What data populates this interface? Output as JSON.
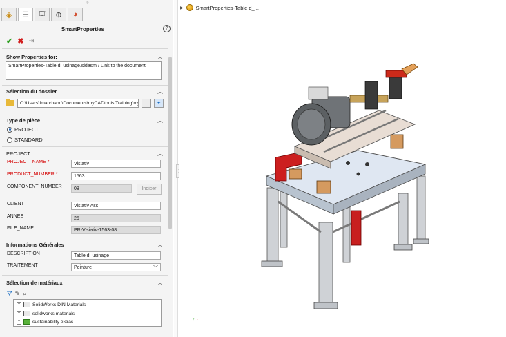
{
  "panel": {
    "title": "SmartProperties",
    "help": "?"
  },
  "show_properties": {
    "heading": "Show Properties for:",
    "value": "SmartProperties-Table d_usinage.sldasm / Link to the document"
  },
  "folder": {
    "heading": "Sélection du dossier",
    "path": "C:\\Users\\fmarchand\\Documents\\myCADtools Training\\my",
    "browse_label": "..."
  },
  "part_type": {
    "heading": "Type de pièce",
    "options": [
      "PROJECT",
      "STANDARD"
    ],
    "selected": "PROJECT"
  },
  "project": {
    "heading": "PROJECT",
    "fields": [
      {
        "label": "PROJECT_NAME *",
        "value": "Visiativ",
        "required": true
      },
      {
        "label": "PRODUCT_NUMBER *",
        "value": "1563",
        "required": true
      },
      {
        "label": "COMPONENT_NUMBER",
        "value": "08",
        "readonly": true
      },
      {
        "label": "CLIENT",
        "value": "Visiativ Ass"
      },
      {
        "label": "ANNEE",
        "value": "25",
        "readonly": true
      },
      {
        "label": "FILE_NAME",
        "value": "PR-Visiativ-1563-08",
        "readonly": true
      }
    ],
    "index_button": "Indicer"
  },
  "general": {
    "heading": "Informations Générales",
    "fields": [
      {
        "label": "DESCRIPTION",
        "value": "Table d_usinage"
      },
      {
        "label": "TRAITEMENT",
        "value": "Peinture",
        "dropdown": true
      }
    ]
  },
  "materials": {
    "heading": "Sélection de matériaux",
    "items": [
      "SolidWorks DIN Materials",
      "solidworks materials",
      "sustainability extras"
    ]
  },
  "viewport": {
    "tree_label": "SmartProperties-Table d_..."
  },
  "colors": {
    "required": "#d40000",
    "ok": "#2a9d1c",
    "cancel": "#d21e1e"
  }
}
